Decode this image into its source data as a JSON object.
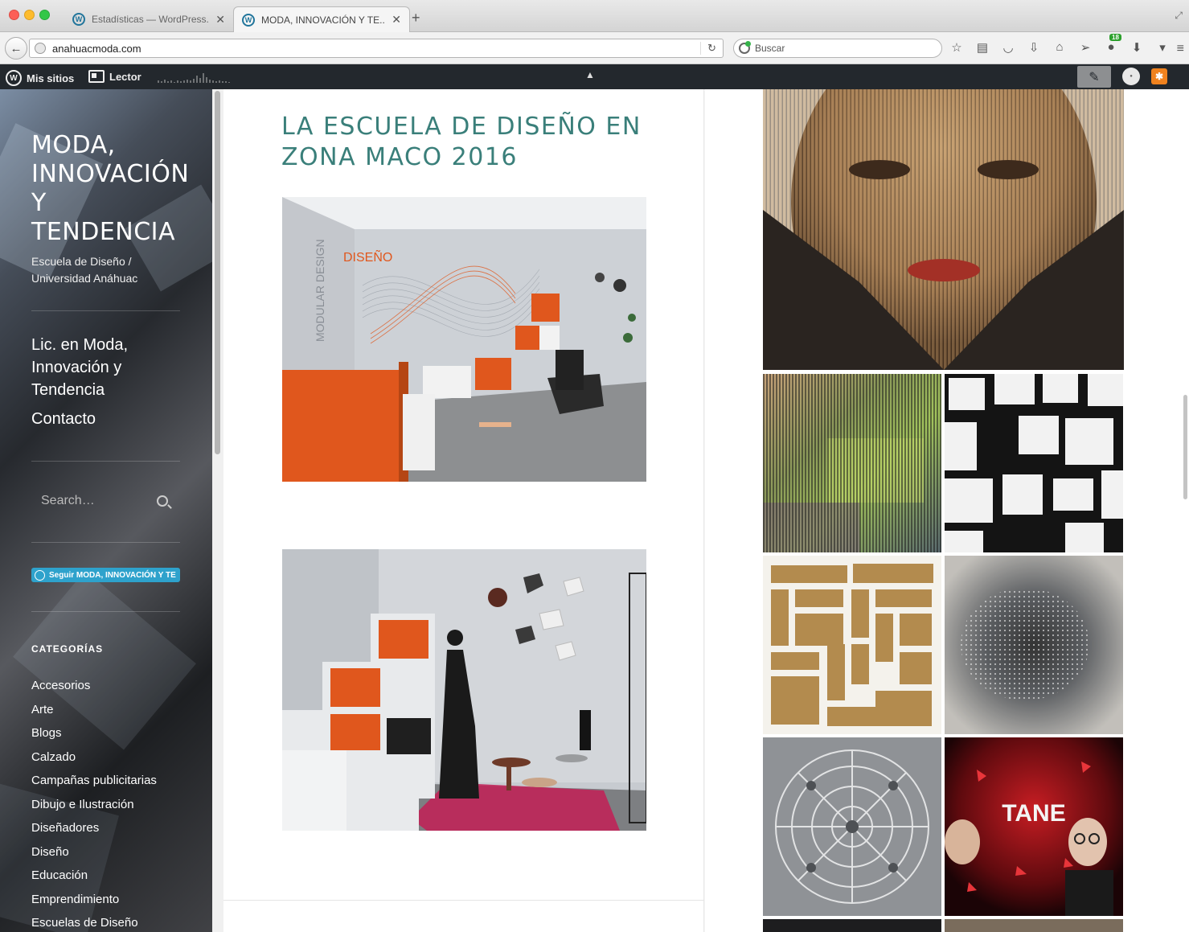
{
  "browser": {
    "tabs": [
      {
        "label": "Estadísticas — WordPress....",
        "active": false
      },
      {
        "label": "MODA, INNOVACIÓN Y TE...",
        "active": true
      }
    ],
    "url": "anahuacmoda.com",
    "search_placeholder": "Buscar",
    "downloads_badge": "18"
  },
  "adminbar": {
    "mis_sitios": "Mis sitios",
    "lector": "Lector"
  },
  "sidebar": {
    "site_title": "MODA, INNOVACIÓN Y TENDENCIA",
    "site_description": "Escuela de Diseño / Universidad Anáhuac",
    "menu": [
      {
        "label": "Lic. en Moda, Innovación y Tendencia"
      },
      {
        "label": "Contacto"
      }
    ],
    "search_placeholder": "Search…",
    "follow_label": "Seguir MODA, INNOVACIÓN Y TE",
    "categories_title": "CATEGORÍAS",
    "categories": [
      "Accesorios",
      "Arte",
      "Blogs",
      "Calzado",
      "Campañas publicitarias",
      "Dibujo e Ilustración",
      "Diseñadores",
      "Diseño",
      "Educación",
      "Emprendimiento",
      "Escuelas de Diseño"
    ]
  },
  "post": {
    "title": "LA ESCUELA DE DISEÑO EN ZONA MACO 2016",
    "photo1_caption": "MODULAR DESIGN",
    "photo1_sign": "DISEÑO"
  },
  "gallery": {
    "tane_text": "TANE"
  },
  "colors": {
    "title_teal": "#3a7f7a",
    "adminbar": "#23282d",
    "follow_blue": "#2ea2cc",
    "booth_orange": "#e0571d"
  }
}
